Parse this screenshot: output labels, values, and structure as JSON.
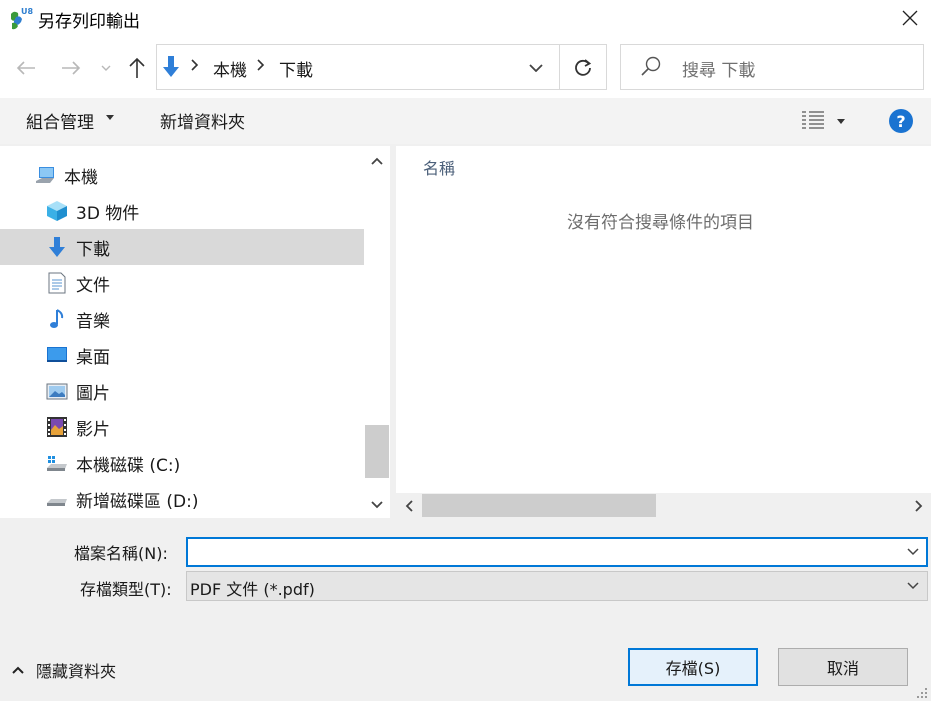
{
  "window": {
    "title": "另存列印輸出",
    "icon": "u8-app-icon"
  },
  "nav": {
    "back_icon": "arrow-left-icon",
    "forward_icon": "arrow-right-icon",
    "up_icon": "arrow-up-icon",
    "breadcrumbs": [
      "本機",
      "下載"
    ],
    "refresh_icon": "refresh-icon",
    "search_placeholder": "搜尋 下載"
  },
  "toolbar": {
    "organize_label": "組合管理",
    "new_folder_label": "新增資料夾",
    "help_label": "?"
  },
  "sidebar": {
    "items": [
      {
        "label": "本機",
        "icon": "computer-icon",
        "selected": false
      },
      {
        "label": "3D 物件",
        "icon": "cube-3d-icon",
        "selected": false
      },
      {
        "label": "下載",
        "icon": "download-arrow-icon",
        "selected": true
      },
      {
        "label": "文件",
        "icon": "document-icon",
        "selected": false
      },
      {
        "label": "音樂",
        "icon": "music-note-icon",
        "selected": false
      },
      {
        "label": "桌面",
        "icon": "desktop-icon",
        "selected": false
      },
      {
        "label": "圖片",
        "icon": "pictures-icon",
        "selected": false
      },
      {
        "label": "影片",
        "icon": "video-icon",
        "selected": false
      },
      {
        "label": "本機磁碟 (C:)",
        "icon": "windows-drive-icon",
        "selected": false
      },
      {
        "label": "新增磁碟區 (D:)",
        "icon": "drive-icon",
        "selected": false
      }
    ]
  },
  "content": {
    "column_name": "名稱",
    "empty_message": "沒有符合搜尋條件的項目"
  },
  "form": {
    "filename_label": "檔案名稱(N):",
    "filename_value": "",
    "type_label": "存檔類型(T):",
    "type_value": "PDF 文件 (*.pdf)"
  },
  "footer": {
    "hide_folders_label": "隱藏資料夾",
    "save_label": "存檔(S)",
    "cancel_label": "取消"
  },
  "colors": {
    "accent": "#0078d7",
    "selected_bg": "#d9d9d9",
    "help_blue": "#1a73d1"
  }
}
